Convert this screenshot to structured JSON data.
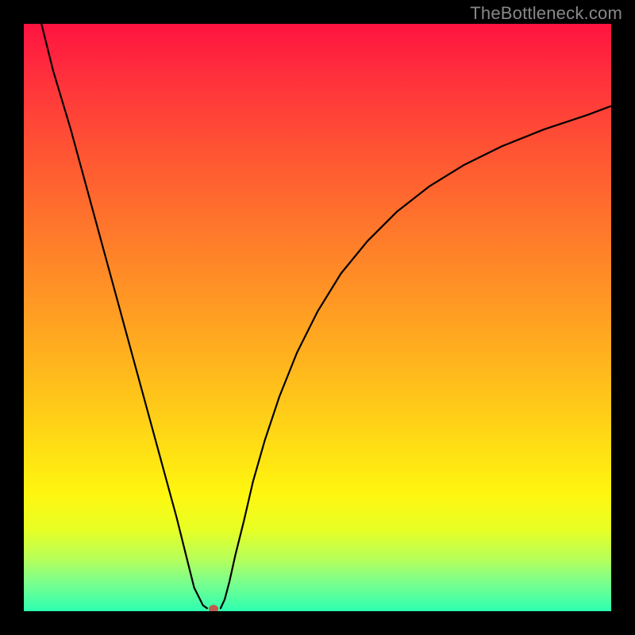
{
  "watermark": "TheBottleneck.com",
  "chart_data": {
    "type": "line",
    "title": "",
    "xlabel": "",
    "ylabel": "",
    "xlim": [
      0,
      100
    ],
    "ylim": [
      0,
      100
    ],
    "grid": false,
    "series": [
      {
        "name": "curve-left",
        "x": [
          3,
          5,
          8,
          11,
          14,
          17,
          20,
          23,
          26,
          28,
          29,
          30.5,
          31.2
        ],
        "y": [
          100,
          92,
          82,
          71,
          60,
          49,
          38,
          27,
          16,
          8,
          4,
          1,
          0.5
        ]
      },
      {
        "name": "curve-right",
        "x": [
          33.5,
          34.2,
          35,
          36,
          37.5,
          39,
          41,
          43.5,
          46.5,
          50,
          54,
          58.5,
          63.5,
          69,
          75,
          81.5,
          88.5,
          96,
          100
        ],
        "y": [
          0.5,
          2,
          5,
          9.5,
          15.5,
          22,
          29,
          36.5,
          44,
          51,
          57.5,
          63,
          68,
          72.3,
          76,
          79.2,
          82,
          84.5,
          86
        ]
      }
    ],
    "marker": {
      "x": 32.3,
      "y": 0.4
    },
    "colors": {
      "curve": "#000000",
      "marker": "#c15a4d"
    },
    "background_gradient": [
      "#ff1340",
      "#ff6a2e",
      "#ffd217",
      "#fff60f",
      "#2dffb0"
    ]
  }
}
